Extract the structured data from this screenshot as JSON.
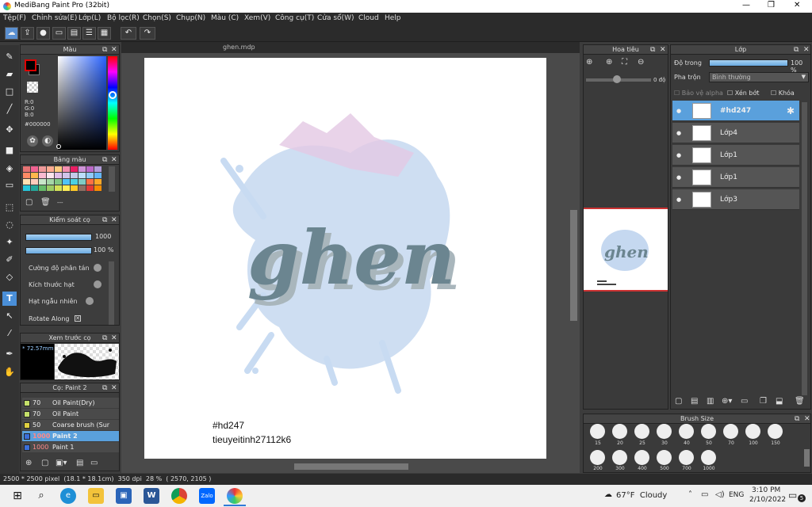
{
  "app": {
    "title": "MediBang Paint Pro (32bit)",
    "min": "—",
    "max": "❒",
    "close": "✕"
  },
  "menu": [
    "Tệp(F)",
    "Chỉnh sửa(E)",
    "Lớp(L)",
    "Bộ lọc(R)",
    "Chọn(S)",
    "Chụp(N)",
    "Màu (C)",
    "Xem(V)",
    "Công cụ(T)",
    "Cửa sổ(W)",
    "Cloud",
    "Help"
  ],
  "canvas": {
    "tab": "ghen.mdp",
    "word": "ghen",
    "caption1": "#hd247",
    "caption2": "tieuyeitinh27112k6"
  },
  "color_panel": {
    "title": "Màu",
    "r": "R:0",
    "g": "G:0",
    "b": "B:0",
    "hex": "#000000"
  },
  "palette": {
    "title": "Bảng màu",
    "extra": "---",
    "swatches": [
      "#e57373",
      "#f06292",
      "#ef9a9a",
      "#ffab91",
      "#ffcc80",
      "#f48fb1",
      "#e91e63",
      "#ce93d8",
      "#ba68c8",
      "#b39ddb",
      "#ff8a65",
      "#ffb74d",
      "#f8bbd0",
      "#fce4ec",
      "#e1bee7",
      "#d1c4e9",
      "#c5cae9",
      "#bbdefb",
      "#90caf9",
      "#64b5f6",
      "#ffe0b2",
      "#ffccbc",
      "#c8e6c9",
      "#a5d6a7",
      "#81c784",
      "#4fc3f7",
      "#4dd0e1",
      "#80cbc4",
      "#ff7043",
      "#ffa726",
      "#26c6da",
      "#26a69a",
      "#66bb6a",
      "#9ccc65",
      "#d4e157",
      "#ffee58",
      "#ffca28",
      "#8d6e63",
      "#e53935",
      "#fb8c00"
    ]
  },
  "brush_control": {
    "title": "Kiểm soát cọ",
    "size": "1000",
    "opacity": "100 %",
    "props": [
      "Cường độ phân tán",
      "Kích thước hạt",
      "Hạt ngẫu nhiên",
      "Rotate Along"
    ]
  },
  "brush_preview": {
    "title": "Xem trước cọ",
    "size": "* 72.57mm"
  },
  "brush_list": {
    "title": "Cọ: Paint 2",
    "items": [
      {
        "size": "70",
        "name": "Oil Paint(Dry)",
        "color": "#c5e06a"
      },
      {
        "size": "70",
        "name": "Oil Paint",
        "color": "#c5e06a"
      },
      {
        "size": "50",
        "name": "Coarse brush (Sur",
        "color": "#e0d040"
      },
      {
        "size": "1000",
        "name": "Paint 2",
        "color": "#3b6fd8"
      },
      {
        "size": "1000",
        "name": "Paint 1",
        "color": "#3b6fd8"
      }
    ]
  },
  "navigator": {
    "title": "Hoa tiêu",
    "angle": "0 độ"
  },
  "layers": {
    "title": "Lớp",
    "opacity_label": "Độ trong",
    "opacity": "100 %",
    "blend_label": "Pha trộn",
    "blend": "Bình thường",
    "protect": "Bảo vệ alpha",
    "clip": "Xén bớt",
    "lock": "Khóa",
    "items": [
      "#hd247",
      "Lớp4",
      "Lớp1",
      "Lớp1",
      "Lớp3"
    ]
  },
  "brush_size": {
    "title": "Brush Size",
    "row1": [
      "15",
      "20",
      "25",
      "30",
      "40",
      "50",
      "70",
      "100",
      "150"
    ],
    "row2": [
      "200",
      "300",
      "400",
      "500",
      "700",
      "1000"
    ]
  },
  "status": {
    "text": "2500 * 2500 pixel  (18.1 * 18.1cm)  350 dpi  28 %  ( 2570, 2105 )"
  },
  "taskbar": {
    "weather": "67°F  Cloudy",
    "lang": "ENG",
    "time": "3:10 PM",
    "date": "2/10/2022",
    "notif": "5"
  },
  "colors": {
    "accent": "#5aa0dc",
    "canvas_bg": "#ffffff",
    "letter": "#6b8590"
  }
}
